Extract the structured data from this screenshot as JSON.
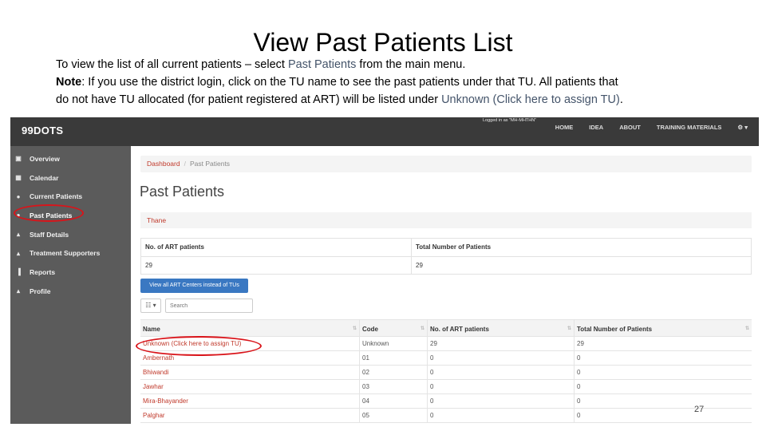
{
  "slide": {
    "title": "View Past Patients List",
    "line1": [
      "To view the list of all current patients – select ",
      "Past Patients",
      " from the main menu."
    ],
    "line2": [
      "Note",
      ": If you use the district login, click on the TU name to see the past patients under that TU.  All patients that"
    ],
    "line3": [
      "do not have TU allocated (for patient registered at ART) will be listed under ",
      "Unknown (Click here to assign TU)",
      "."
    ],
    "page_number": "27"
  },
  "app": {
    "logo": "99DOTS",
    "logged_in": "Logged in as \"MH-MHTHN\"",
    "nav": [
      "HOME",
      "IDEA",
      "ABOUT",
      "TRAINING MATERIALS",
      "⚙ ▾"
    ]
  },
  "sidebar": {
    "items": [
      {
        "label": "Overview",
        "icon": "dashboard-icon",
        "glyph": "▣"
      },
      {
        "label": "Calendar",
        "icon": "calendar-icon",
        "glyph": "▦"
      },
      {
        "label": "Current Patients",
        "icon": "users-icon",
        "glyph": "●"
      },
      {
        "label": "Past Patients",
        "icon": "user-icon",
        "glyph": "●"
      },
      {
        "label": "Staff Details",
        "icon": "staff-icon",
        "glyph": "▴"
      },
      {
        "label": "Treatment Supporters",
        "icon": "supporter-icon",
        "glyph": "▴"
      },
      {
        "label": "Reports",
        "icon": "bar-chart-icon",
        "glyph": "▐"
      },
      {
        "label": "Profile",
        "icon": "profile-icon",
        "glyph": "▴"
      }
    ]
  },
  "main": {
    "breadcrumb": {
      "link": "Dashboard",
      "separator": "/",
      "current": "Past Patients"
    },
    "heading": "Past Patients",
    "district": "Thane",
    "summary": {
      "headers": [
        "No. of ART patients",
        "Total Number of Patients"
      ],
      "values": [
        "29",
        "29"
      ]
    },
    "view_button": "View all ART Centers instead of TUs",
    "columns_button": "☷ ▾",
    "search_placeholder": "Search",
    "table": {
      "headers": [
        "Name",
        "Code",
        "No. of ART patients",
        "Total Number of Patients"
      ],
      "sort_glyph": "⇅",
      "rows": [
        [
          "Unknown (Click here to assign TU)",
          "Unknown",
          "29",
          "29"
        ],
        [
          "Ambernath",
          "01",
          "0",
          "0"
        ],
        [
          "Bhiwandi",
          "02",
          "0",
          "0"
        ],
        [
          "Jawhar",
          "03",
          "0",
          "0"
        ],
        [
          "Mira-Bhayander",
          "04",
          "0",
          "0"
        ],
        [
          "Palghar",
          "05",
          "0",
          "0"
        ]
      ]
    }
  },
  "colors": {
    "highlight_oval": "#d9141a",
    "link": "#c0392b",
    "button": "#3a78c2",
    "topbar": "#3a3a3a",
    "sidebar": "#5b5b5b"
  }
}
